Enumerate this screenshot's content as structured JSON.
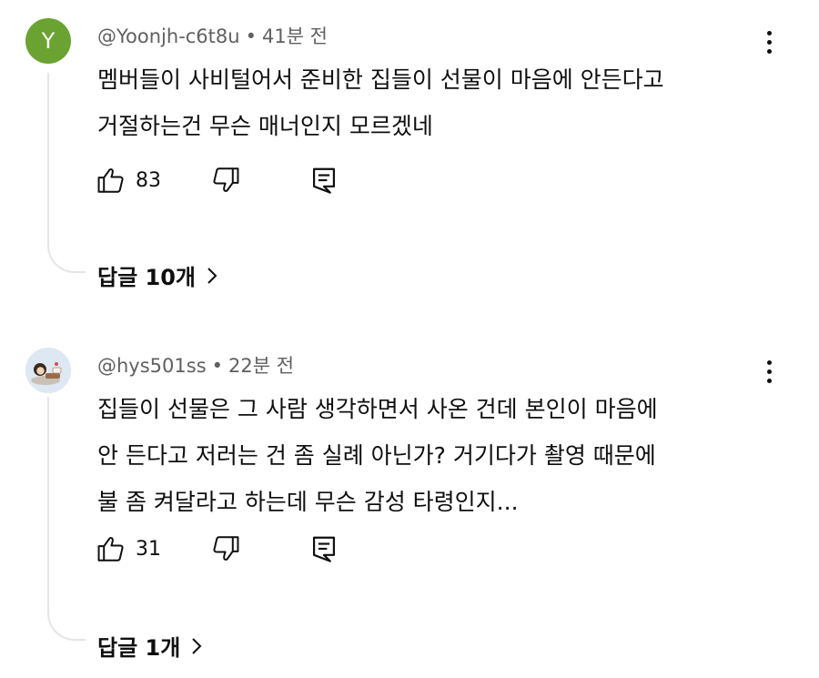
{
  "comments": [
    {
      "avatar_letter": "Y",
      "author": "@Yoonjh-c6t8u",
      "separator": "•",
      "time": "41분 전",
      "lines": [
        "멤버들이 사비털어서 준비한 집들이 선물이 마음에 안든다고",
        "거절하는건 무슨 매너인지 모르겠네"
      ],
      "likes": "83",
      "replies_label": "답글 10개"
    },
    {
      "avatar_letter": "",
      "author": "@hys501ss",
      "separator": "•",
      "time": "22분 전",
      "lines": [
        "집들이 선물은 그 사람 생각하면서 사온 건데 본인이 마음에",
        "안 든다고 저러는 건 좀 실례 아닌가? 거기다가 촬영 때문에",
        "불 좀 켜달라고 하는데 무슨 감성 타령인지..."
      ],
      "likes": "31",
      "replies_label": "답글 1개"
    }
  ],
  "icons": {
    "like": "thumbs-up-icon",
    "dislike": "thumbs-down-icon",
    "reply": "reply-comment-icon",
    "more": "more-vertical-icon",
    "chevron": "chevron-right-icon"
  },
  "colors": {
    "avatar_green": "#6aa332",
    "meta_gray": "#606060",
    "thread_line": "#e5e5e5"
  }
}
